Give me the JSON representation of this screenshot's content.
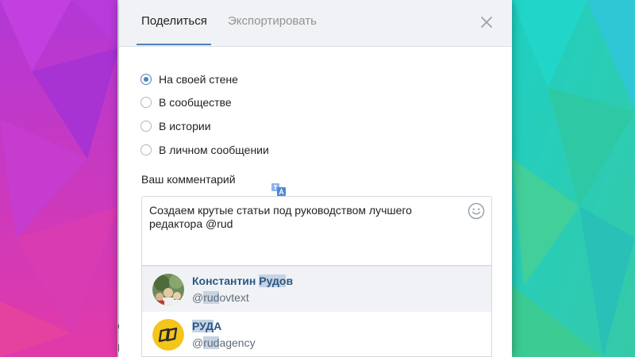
{
  "dialog": {
    "tabs": [
      {
        "label": "Поделиться",
        "active": true
      },
      {
        "label": "Экспортировать",
        "active": false
      }
    ],
    "close_icon": "close-icon"
  },
  "share_options": [
    {
      "label": "На своей стене",
      "checked": true
    },
    {
      "label": "В сообществе",
      "checked": false
    },
    {
      "label": "В истории",
      "checked": false
    },
    {
      "label": "В личном сообщении",
      "checked": false
    }
  ],
  "comment": {
    "label": "Ваш комментарий",
    "value": "Создаем крутые статьи под руководством лучшего редактора @rud"
  },
  "mention_suggestions": [
    {
      "name_prefix": "Константин ",
      "name_match": "Рудо",
      "name_suffix": "в",
      "handle_prefix": "@",
      "handle_match": "rud",
      "handle_suffix": "ovtext",
      "highlighted": true
    },
    {
      "name_prefix": "",
      "name_match": "РУД",
      "name_suffix": "А",
      "handle_prefix": "@",
      "handle_match": "rud",
      "handle_suffix": "agency",
      "highlighted": false
    }
  ],
  "colors": {
    "accent": "#5181b8",
    "link": "#2a5885",
    "header_bg": "#f0f2f5",
    "logo_yellow": "#f4c51a"
  }
}
